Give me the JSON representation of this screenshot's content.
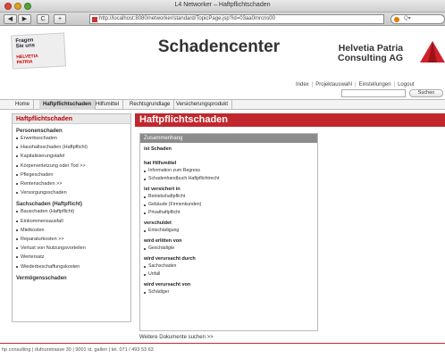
{
  "window": {
    "title": "L4 Networker – Haftpflichtschaden"
  },
  "browser": {
    "url": "http://localhost:8080/networker/standard/TopicPage.jsp?id=03aa0mrcns00",
    "search_text": "Q▾",
    "back_glyph": "◀",
    "forward_glyph": "▶",
    "reload_glyph": "C",
    "add_glyph": "+"
  },
  "logo_left": {
    "line1": "Fragen",
    "line2": "Sie uns",
    "line3": "HELVETIA",
    "line4": "PATRIA"
  },
  "site_title": "Schadencenter",
  "brand": {
    "line1": "Helvetia Patria",
    "line2": "Consulting AG"
  },
  "util_links": [
    "Index",
    "Projektauswahl",
    "Einstellungen",
    "Logout"
  ],
  "search_button": "Suchen",
  "nav_tabs": [
    "Home",
    "Haftpflichtschaden",
    "Hilfsmittel",
    "Rechtsgrundlage",
    "Versicherungsprodukt"
  ],
  "sidebar": {
    "title": "Haftpflichtschaden",
    "sections": [
      {
        "label": "Personenschaden",
        "items": [
          "Erwerbsschaden",
          "Haushaltsschaden (Haftpflicht)",
          "Kapitalisierungstafel",
          "Körperverletzung oder Tod >>",
          "Pflegeschaden",
          "Rentenschaden >>",
          "Versorgungsschaden"
        ]
      },
      {
        "label": "Sachschaden (Haftpflicht)",
        "items": [
          "Bauschaden (Haftpflicht)",
          "Einkommensausfall",
          "Mietkosten",
          "Reparaturkosten >>",
          "Verlust von Nutzungsvorteilen",
          "Wertersatz",
          "Wiederbeschaffungskosten"
        ]
      },
      {
        "label": "Vermögensschaden",
        "items": []
      }
    ]
  },
  "page_title": "Haftpflichtschaden",
  "panel": {
    "header": "Zusammenhang",
    "groups": [
      {
        "heading": "ist Schaden",
        "items": []
      },
      {
        "heading": "hat Hilfsmittel",
        "items": [
          "Information zum Regress",
          "Schadenhandbuch Haftpflichtrecht"
        ]
      },
      {
        "heading": "ist versichert in",
        "items": [
          "Betriebshaftpflicht",
          "Gebäude (Firmenkunden)",
          "Privathaftpflicht"
        ]
      },
      {
        "heading": "verschuldet",
        "items": [
          "Entschädigung"
        ]
      },
      {
        "heading": "wird erlitten von",
        "items": [
          "Geschädigte"
        ]
      },
      {
        "heading": "wird verursacht durch",
        "items": [
          "Sachschaden",
          "Unfall"
        ]
      },
      {
        "heading": "wird verursacht von",
        "items": [
          "Schädiger"
        ]
      }
    ]
  },
  "more_link": "Weitere Dokumente suchen >>",
  "footer": "hp consulting | dufourstrasse 30 | 9001 st. gallen | tel. 071 / 493 53 63",
  "colors": {
    "accent": "#c1272d",
    "panel_head": "#8c8c8c",
    "brand_red": "#d0202a"
  }
}
